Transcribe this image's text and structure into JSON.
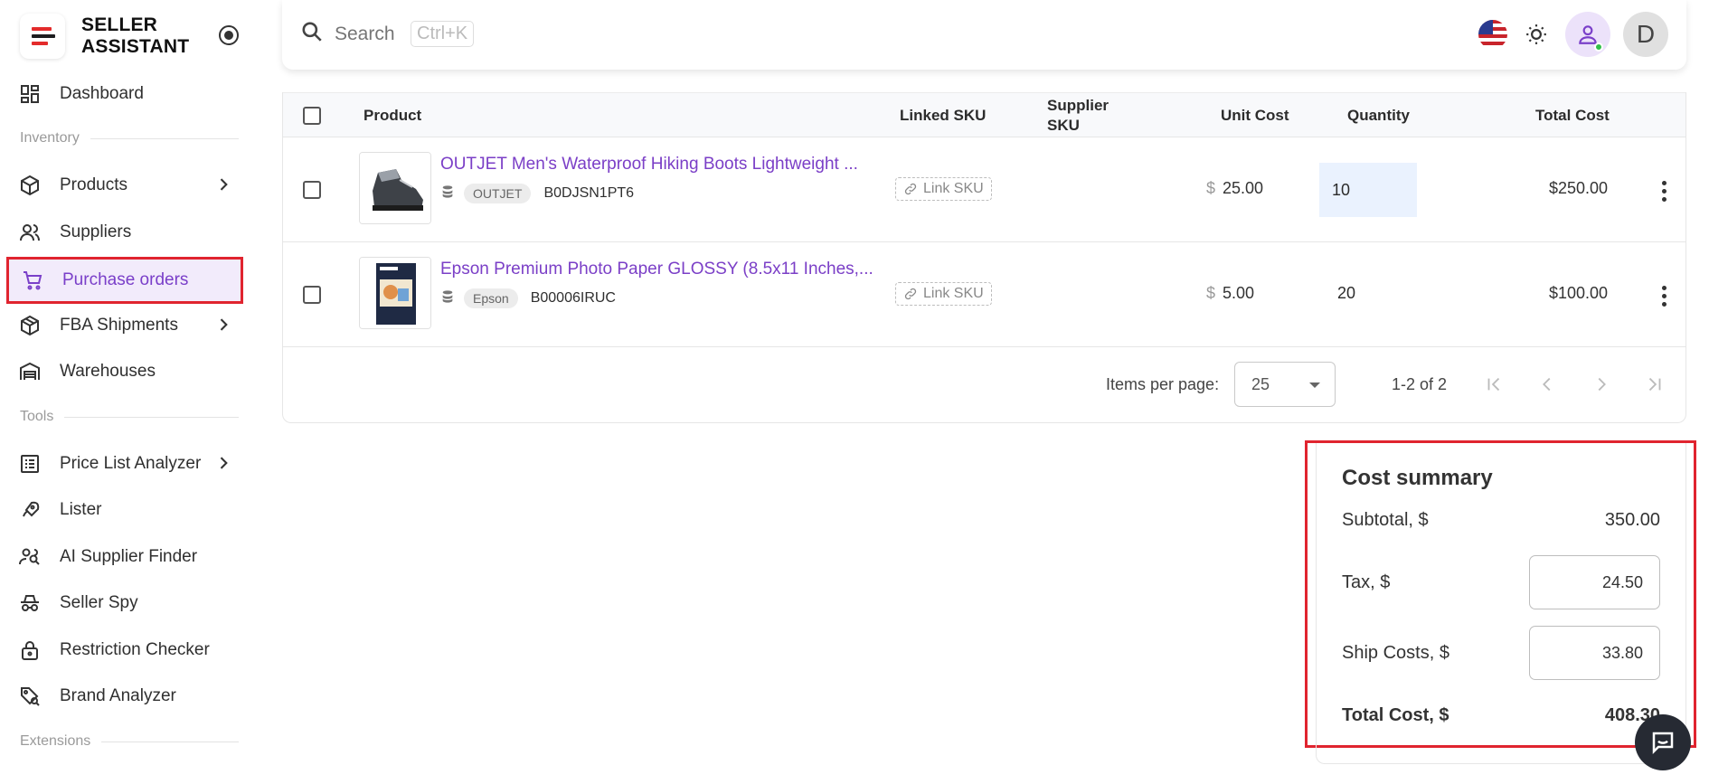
{
  "brand": {
    "name": "SELLER ASSISTANT"
  },
  "sidebar": {
    "items": [
      {
        "label": "Dashboard"
      },
      {
        "label": "Products"
      },
      {
        "label": "Suppliers"
      },
      {
        "label": "Purchase orders"
      },
      {
        "label": "FBA Shipments"
      },
      {
        "label": "Warehouses"
      },
      {
        "label": "Price List Analyzer"
      },
      {
        "label": "Lister"
      },
      {
        "label": "AI Supplier Finder"
      },
      {
        "label": "Seller Spy"
      },
      {
        "label": "Restriction Checker"
      },
      {
        "label": "Brand Analyzer"
      }
    ],
    "sections": {
      "inventory": "Inventory",
      "tools": "Tools",
      "extensions": "Extensions"
    }
  },
  "header": {
    "search_placeholder": "Search",
    "shortcut": "Ctrl+K",
    "avatar_initial": "D"
  },
  "table": {
    "headers": {
      "product": "Product",
      "linked_sku": "Linked SKU",
      "supplier_sku": "Supplier SKU",
      "unit_cost": "Unit Cost",
      "quantity": "Quantity",
      "total_cost": "Total Cost"
    },
    "rows": [
      {
        "name": "OUTJET Men's Waterproof Hiking Boots Lightweight ...",
        "brand": "OUTJET",
        "asin": "B0DJSN1PT6",
        "link_sku": "Link SKU",
        "currency": "$",
        "unit_cost": "25.00",
        "quantity": "10",
        "total": "$250.00"
      },
      {
        "name": "Epson Premium Photo Paper GLOSSY (8.5x11 Inches,...",
        "brand": "Epson",
        "asin": "B00006IRUC",
        "link_sku": "Link SKU",
        "currency": "$",
        "unit_cost": "5.00",
        "quantity": "20",
        "total": "$100.00"
      }
    ],
    "pagination": {
      "items_per_page_label": "Items per page:",
      "per_page": "25",
      "range": "1-2 of 2"
    }
  },
  "summary": {
    "title": "Cost summary",
    "subtotal_label": "Subtotal, $",
    "subtotal": "350.00",
    "tax_label": "Tax, $",
    "tax": "24.50",
    "ship_label": "Ship Costs, $",
    "ship": "33.80",
    "total_label": "Total Cost, $",
    "total": "408.30"
  },
  "colors": {
    "accent": "#7a3fc9",
    "highlight": "#e0242f",
    "brand_red": "#e32b2b"
  }
}
